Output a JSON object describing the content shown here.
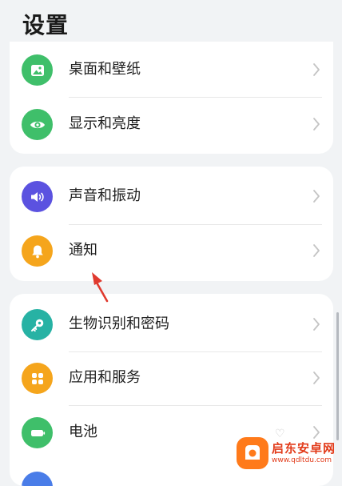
{
  "header": {
    "title": "设置"
  },
  "groups": [
    {
      "items": [
        {
          "label": "桌面和壁纸",
          "icon": "wallpaper-icon",
          "color": "#3fbf6a"
        },
        {
          "label": "显示和亮度",
          "icon": "eye-icon",
          "color": "#3fbf6a"
        }
      ]
    },
    {
      "items": [
        {
          "label": "声音和振动",
          "icon": "speaker-icon",
          "color": "#5b52e0"
        },
        {
          "label": "通知",
          "icon": "bell-icon",
          "color": "#f5a51c"
        }
      ]
    },
    {
      "items": [
        {
          "label": "生物识别和密码",
          "icon": "key-icon",
          "color": "#27b2a4"
        },
        {
          "label": "应用和服务",
          "icon": "apps-icon",
          "color": "#f5a51c"
        },
        {
          "label": "电池",
          "icon": "battery-icon",
          "color": "#3fbf6a"
        }
      ]
    }
  ],
  "annotation": {
    "arrow_color": "#e03a2f"
  },
  "watermark": {
    "name": "启东安卓网",
    "url": "www.qdltdu.com"
  }
}
